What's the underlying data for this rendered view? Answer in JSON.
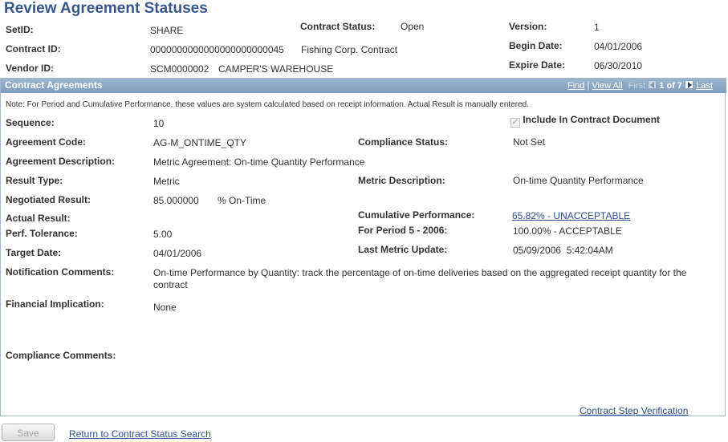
{
  "page": {
    "title": "Review Agreement Statuses"
  },
  "header": {
    "setid_label": "SetID:",
    "setid_value": "SHARE",
    "contract_status_label": "Contract Status:",
    "contract_status_value": "Open",
    "version_label": "Version:",
    "version_value": "1",
    "contract_id_label": "Contract ID:",
    "contract_id_value": "0000000000000000000000045",
    "contract_desc": "Fishing Corp. Contract",
    "begin_date_label": "Begin Date:",
    "begin_date_value": "04/01/2006",
    "vendor_id_label": "Vendor ID:",
    "vendor_id_value": "SCM0000002",
    "vendor_name": "CAMPER'S WAREHOUSE",
    "expire_date_label": "Expire Date:",
    "expire_date_value": "06/30/2010"
  },
  "panel": {
    "title": "Contract Agreements",
    "nav": {
      "find": "Find",
      "separator": "|",
      "view_all": "View All",
      "first": "First",
      "counter": "1 of 7",
      "last": "Last"
    },
    "note": "Note: For Period and Cumulative Performance, these values are system calculated based on receipt information.  Actual Result is manually entered.",
    "include_checkbox": {
      "label": "Include In Contract Document",
      "checked": true,
      "disabled": true
    },
    "fields": {
      "sequence_label": "Sequence:",
      "sequence_value": "10",
      "agreement_code_label": "Agreement Code:",
      "agreement_code_value": "AG-M_ONTIME_QTY",
      "compliance_status_label": "Compliance Status:",
      "compliance_status_value": "Not Set",
      "agreement_desc_label": "Agreement Description:",
      "agreement_desc_value": "Metric Agreement: On-time Quantity Performance",
      "result_type_label": "Result Type:",
      "result_type_value": "Metric",
      "metric_desc_label": "Metric Description:",
      "metric_desc_value": "On-time Quantity Performance",
      "negotiated_result_label": "Negotiated Result:",
      "negotiated_result_value": "85.000000",
      "negotiated_result_unit": "% On-Time",
      "actual_result_label": "Actual Result:",
      "cumulative_perf_label": "Cumulative Performance:",
      "cumulative_perf_value": "65.82% - UNACCEPTABLE",
      "perf_tolerance_label": "Perf. Tolerance:",
      "perf_tolerance_value": "5.00",
      "period_label": "For Period 5 - 2006:",
      "period_value": "100.00% - ACCEPTABLE",
      "target_date_label": "Target Date:",
      "target_date_value": "04/01/2006",
      "last_metric_update_label": "Last Metric Update:",
      "last_metric_update_value": "05/09/2006  5:42:04AM",
      "notification_comments_label": "Notification Comments:",
      "notification_comments_value": "On-time Performance by Quantity: track the percentage of on-time deliveries based on the aggregated receipt quantity for the contract",
      "financial_implication_label": "Financial Implication:",
      "financial_implication_value": "None",
      "compliance_comments_label": "Compliance Comments:"
    },
    "step_verification_link": "Contract Step Verification"
  },
  "footer": {
    "save_label": "Save",
    "return_link": "Return to Contract Status Search"
  }
}
